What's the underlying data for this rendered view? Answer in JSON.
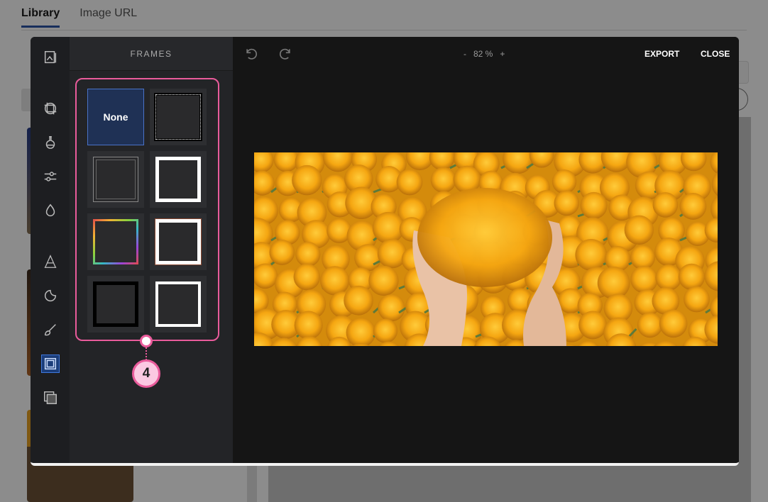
{
  "background": {
    "tabs": [
      {
        "label": "Library",
        "active": true
      },
      {
        "label": "Image URL",
        "active": false
      }
    ]
  },
  "editor": {
    "panel_title": "FRAMES",
    "zoom": {
      "minus": "-",
      "value": "82 %",
      "plus": "+"
    },
    "export_label": "EXPORT",
    "close_label": "CLOSE",
    "frames": [
      {
        "name": "none",
        "label": "None",
        "selected": true
      },
      {
        "name": "dotted-film",
        "label": ""
      },
      {
        "name": "ornate-corners",
        "label": ""
      },
      {
        "name": "thick-white",
        "label": ""
      },
      {
        "name": "rainbow-gradient",
        "label": ""
      },
      {
        "name": "white-burned-edge",
        "label": ""
      },
      {
        "name": "thick-black",
        "label": ""
      },
      {
        "name": "thin-white",
        "label": ""
      }
    ],
    "tools": [
      "image-icon",
      "crop-icon",
      "filter-flask-icon",
      "adjust-sliders-icon",
      "focus-drop-icon",
      "text-icon",
      "sticker-icon",
      "brush-icon",
      "frame-icon",
      "overlay-icon"
    ]
  },
  "callout": {
    "number": "4",
    "color": "#e95b9b"
  },
  "colors": {
    "accent": "#4a72c7",
    "callout": "#e95b9b",
    "marigold": "#f2a516"
  }
}
